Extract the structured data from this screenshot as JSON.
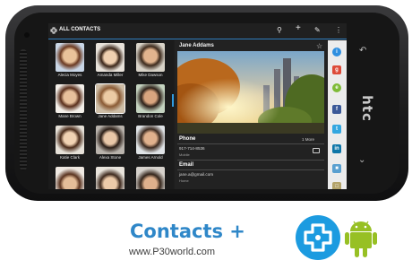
{
  "header": {
    "title": "ALL CONTACTS"
  },
  "contacts": [
    {
      "name": "Alecia Moyes"
    },
    {
      "name": "Amanda Miller"
    },
    {
      "name": "Mike Dawson"
    },
    {
      "name": "Mane Brown"
    },
    {
      "name": "Jane Addams"
    },
    {
      "name": "Brandon Cole"
    },
    {
      "name": "Katie Clark"
    },
    {
      "name": "Alexa Stone"
    },
    {
      "name": "James Arnold"
    },
    {
      "name": ""
    },
    {
      "name": ""
    },
    {
      "name": ""
    }
  ],
  "detail": {
    "name": "Jane Addams",
    "phone_label": "Phone",
    "more_label": "1 More",
    "phone_number": "917-714-8536",
    "phone_type": "Mobile",
    "email_label": "Email",
    "email_value": "jane.a@gmail.com",
    "email_type": "Home"
  },
  "social_icons": [
    "info",
    "google-plus",
    "evernote",
    "facebook",
    "twitter",
    "linkedin",
    "photos",
    "box"
  ],
  "branding": {
    "title": "Contacts +",
    "url": "www.P30world.com"
  },
  "colors": {
    "accent": "#2f87c8",
    "selection": "#2f9be0"
  }
}
